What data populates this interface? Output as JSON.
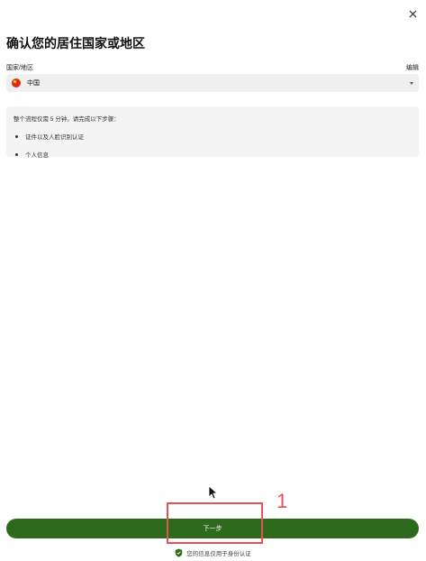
{
  "dialog": {
    "title": "确认您的居住国家或地区",
    "close_icon": "close-icon"
  },
  "country_field": {
    "label": "国家/地区",
    "edit_label": "编辑",
    "selected_value": "中国",
    "flag_icon": "china-flag-icon"
  },
  "info": {
    "intro": "整个流程仅需 5 分钟。请完成以下步骤：",
    "items": [
      "证件以及人脸识别认证",
      "个人信息"
    ]
  },
  "footer": {
    "next_label": "下一步",
    "privacy_note": "您的信息仅用于身份认证"
  },
  "annotation": {
    "number": "1",
    "color": "#e5515b"
  },
  "colors": {
    "primary_button": "#2d6a1b",
    "input_bg": "#efefef",
    "info_bg": "#f4f4f4"
  }
}
